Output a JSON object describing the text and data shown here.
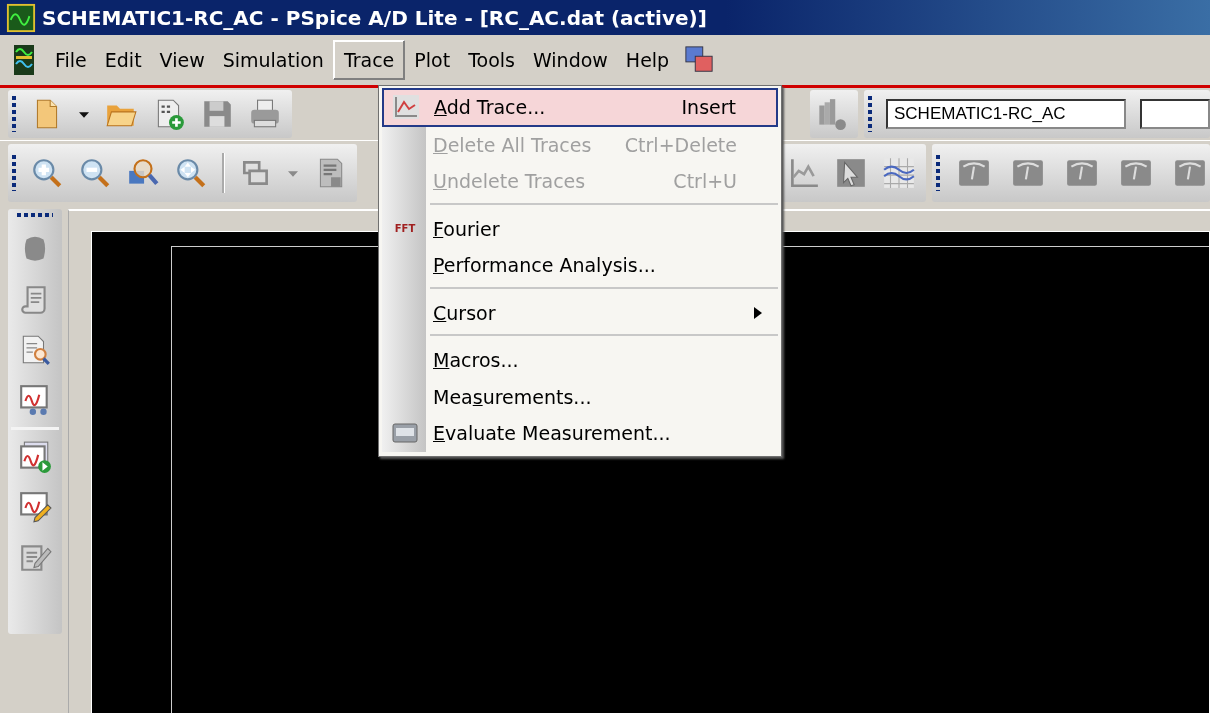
{
  "window": {
    "title": "SCHEMATIC1-RC_AC - PSpice A/D Lite - [RC_AC.dat (active)]"
  },
  "menu_bar": [
    {
      "label": "File",
      "selected": false
    },
    {
      "label": "Edit",
      "selected": false
    },
    {
      "label": "View",
      "selected": false
    },
    {
      "label": "Simulation",
      "selected": false
    },
    {
      "label": "Trace",
      "selected": true
    },
    {
      "label": "Plot",
      "selected": false
    },
    {
      "label": "Tools",
      "selected": false
    },
    {
      "label": "Window",
      "selected": false
    },
    {
      "label": "Help",
      "selected": false
    }
  ],
  "toolbar": {
    "profile_field": {
      "value": "SCHEMATIC1-RC_AC"
    }
  },
  "trace_menu": [
    {
      "kind": "item",
      "access_key": "A",
      "label_rest": "dd Trace...",
      "shortcut": "Insert",
      "selected": true,
      "disabled": false
    },
    {
      "kind": "item",
      "access_key": "D",
      "label_rest": "elete All Traces",
      "shortcut": "Ctrl+Delete",
      "selected": false,
      "disabled": true
    },
    {
      "kind": "item",
      "access_key": "U",
      "label_rest": "ndelete Traces",
      "shortcut": "Ctrl+U",
      "selected": false,
      "disabled": true
    },
    {
      "kind": "separator"
    },
    {
      "kind": "item",
      "access_key": "F",
      "label_rest": "ourier",
      "icon_text": "FFT",
      "selected": false,
      "disabled": false
    },
    {
      "kind": "item",
      "access_key": "P",
      "label_rest": "erformance Analysis...",
      "selected": false,
      "disabled": false
    },
    {
      "kind": "separator"
    },
    {
      "kind": "submenu",
      "access_key": "C",
      "label_rest": "ursor",
      "selected": false,
      "disabled": false
    },
    {
      "kind": "separator"
    },
    {
      "kind": "item",
      "access_key": "M",
      "label_rest": "acros...",
      "selected": false,
      "disabled": false
    },
    {
      "kind": "item",
      "label_start": "Mea",
      "access_key": "s",
      "label_rest": "urements...",
      "selected": false,
      "disabled": false
    },
    {
      "kind": "item",
      "access_key": "E",
      "label_rest": "valuate Measurement...",
      "selected": false,
      "disabled": false
    }
  ]
}
